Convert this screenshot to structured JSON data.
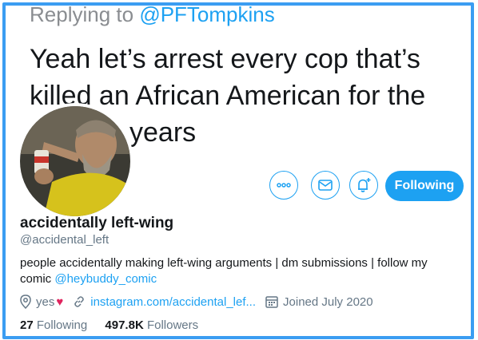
{
  "reply": {
    "prefix": "Replying to ",
    "handle": "@PFTompkins"
  },
  "tweet": {
    "line1": "Yeah let’s arrest every cop that’s",
    "line2": "killed an African American for the",
    "line3": "years"
  },
  "profile": {
    "name": "accidentally left-wing",
    "handle": "@accidental_left",
    "bio_text": "people accidentally making left-wing arguments | dm submissions | follow my comic ",
    "bio_link": "@heybuddy_comic",
    "location": "yes",
    "location_heart": "♥",
    "website": "instagram.com/accidental_lef...",
    "joined": "Joined July 2020",
    "following_count": "27",
    "following_label": "Following",
    "followers_count": "497.8K",
    "followers_label": "Followers"
  },
  "buttons": {
    "follow_label": "Following"
  },
  "icons": [
    "more-icon",
    "message-icon",
    "notification-bell-icon",
    "location-pin-icon",
    "link-icon",
    "calendar-icon"
  ],
  "colors": {
    "accent": "#1da1f2",
    "border": "#3b9df2",
    "heart": "#e0245e",
    "muted": "#657786"
  }
}
